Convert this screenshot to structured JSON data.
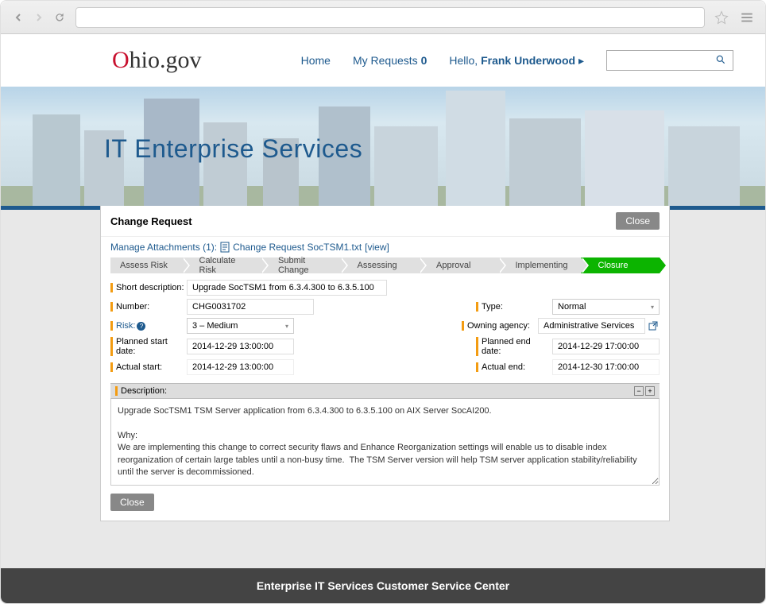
{
  "header": {
    "logo_o": "O",
    "logo_rest": "hio.gov",
    "nav": {
      "home": "Home",
      "my_requests": "My Requests",
      "my_requests_count": "0",
      "greeting_prefix": "Hello, ",
      "user_name": "Frank Underwood",
      "greeting_suffix": " ▸"
    }
  },
  "banner": {
    "title": "IT Enterprise Services"
  },
  "panel": {
    "title": "Change Request",
    "close": "Close",
    "attachments": {
      "label": "Manage Attachments (1):",
      "file_name": "Change Request SocTSM1.txt",
      "view": "[view]"
    }
  },
  "stepper": [
    "Assess Risk",
    "Calculate Risk",
    "Submit Change",
    "Assessing",
    "Approval",
    "Implementing",
    "Closure"
  ],
  "form": {
    "short_description_label": "Short description:",
    "short_description": "Upgrade SocTSM1 from 6.3.4.300 to 6.3.5.100",
    "number_label": "Number:",
    "number": "CHG0031702",
    "type_label": "Type:",
    "type": "Normal",
    "risk_label": "Risk:",
    "risk": "3 – Medium",
    "owning_agency_label": "Owning agency:",
    "owning_agency": "Administrative Services",
    "planned_start_label": "Planned start date:",
    "planned_start": "2014-12-29 13:00:00",
    "planned_end_label": "Planned end date:",
    "planned_end": "2014-12-29 17:00:00",
    "actual_start_label": "Actual start:",
    "actual_start": "2014-12-29 13:00:00",
    "actual_end_label": "Actual end:",
    "actual_end": "2014-12-30 17:00:00"
  },
  "description": {
    "label": "Description:",
    "body": "Upgrade SocTSM1 TSM Server application from 6.3.4.300 to 6.3.5.100 on AIX Server SocAI200.\n\nWhy:\nWe are implementing this change to correct security flaws and Enhance Reorganization settings will enable us to disable index reorganization of certain large tables until a non-busy time.  The TSM Server version will help TSM server application stability/reliability until the server is decommissioned."
  },
  "footer": {
    "text": "Enterprise IT Services Customer Service Center"
  }
}
